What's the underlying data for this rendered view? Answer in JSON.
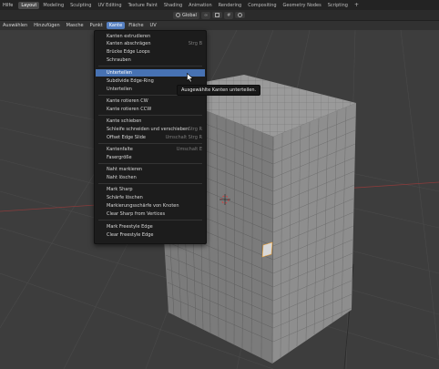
{
  "topbar": {
    "app_menu": "Hilfe",
    "tabs": [
      "Layout",
      "Modeling",
      "Sculpting",
      "UV Editing",
      "Texture Paint",
      "Shading",
      "Animation",
      "Rendering",
      "Compositing",
      "Geometry Nodes",
      "Scripting"
    ],
    "active_tab": "Layout",
    "plus": "+"
  },
  "header": {
    "orientation": "Global"
  },
  "editor_menu": {
    "items": [
      "Auswählen",
      "Hinzufügen",
      "Masche",
      "Punkt",
      "Kante",
      "Fläche",
      "UV"
    ],
    "active": "Kante"
  },
  "menu": {
    "items": [
      {
        "label": "Kanten extrudieren",
        "shortcut": ""
      },
      {
        "label": "Kanten abschrägen",
        "shortcut": "Strg B"
      },
      {
        "label": "Brücke Edge Loops",
        "shortcut": ""
      },
      {
        "label": "Schrauben",
        "shortcut": ""
      },
      {
        "label": "Unterteilen",
        "shortcut": ""
      },
      {
        "label": "Subdivide Edge-Ring",
        "shortcut": ""
      },
      {
        "label": "Unterteilen",
        "shortcut": ""
      },
      {
        "label": "Kante rotieren CW",
        "shortcut": ""
      },
      {
        "label": "Kante rotieren CCW",
        "shortcut": ""
      },
      {
        "label": "Kante schieben",
        "shortcut": ""
      },
      {
        "label": "Schleife schneiden und verschieben",
        "shortcut": "Strg R"
      },
      {
        "label": "Offset Edge Slide",
        "shortcut": "Umschalt Strg R"
      },
      {
        "label": "Kantenfalte",
        "shortcut": "Umschalt E"
      },
      {
        "label": "Fasergröße",
        "shortcut": ""
      },
      {
        "label": "Naht markieren",
        "shortcut": ""
      },
      {
        "label": "Naht löschen",
        "shortcut": ""
      },
      {
        "label": "Mark Sharp",
        "shortcut": ""
      },
      {
        "label": "Schärfe löschen",
        "shortcut": ""
      },
      {
        "label": "Mark Sharp from Vertices",
        "shortcut": ""
      },
      {
        "label": "Clear Sharp from Vertices",
        "shortcut": ""
      },
      {
        "label": "Mark Freestyle Edge",
        "shortcut": ""
      },
      {
        "label": "Clear Freestyle Edge",
        "shortcut": ""
      }
    ],
    "extra_labels": {
      "marking": "Markierungsschärfe von Knoten"
    },
    "highlighted_index": 4
  },
  "tooltip": "Ausgewählte Kanten unterteilen.",
  "colors": {
    "menu_bg": "#1c1c1c",
    "highlight": "#4772b3",
    "viewport_bg": "#3d3d3d",
    "cube_top": "#9a9a9a",
    "cube_front": "#7b7b7b",
    "cube_side": "#8e8e8e"
  }
}
